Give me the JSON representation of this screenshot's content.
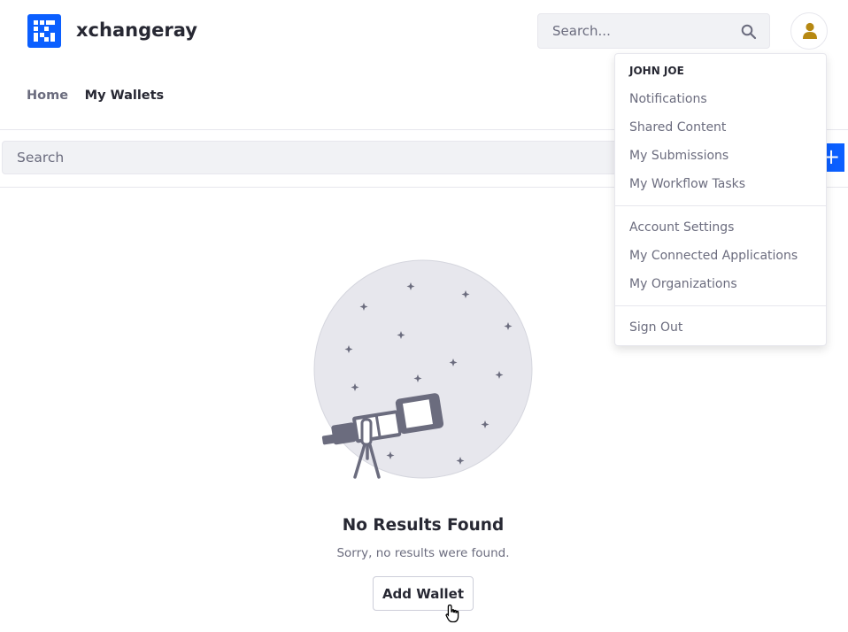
{
  "site": {
    "name": "xchangeray"
  },
  "header": {
    "search_placeholder": "Search...",
    "search_icon": "search-icon",
    "user_icon": "user-icon"
  },
  "nav": {
    "home": "Home",
    "current": "My Wallets"
  },
  "management": {
    "search_placeholder": "Search",
    "add_icon": "plus-icon"
  },
  "empty_state": {
    "title": "No Results Found",
    "description": "Sorry, no results were found.",
    "button": "Add Wallet",
    "illustration": "telescope-illustration"
  },
  "user_menu": {
    "header": "JOHN JOE",
    "group1": [
      "Notifications",
      "Shared Content",
      "My Submissions",
      "My Workflow Tasks"
    ],
    "group2": [
      "Account Settings",
      "My Connected Applications",
      "My Organizations"
    ],
    "group3": [
      "Sign Out"
    ]
  },
  "colors": {
    "primary": "#0b5fff",
    "text": "#272833",
    "secondary_text": "#6b6c7e",
    "input_bg": "#f1f2f5",
    "user_icon": "#b68812"
  }
}
